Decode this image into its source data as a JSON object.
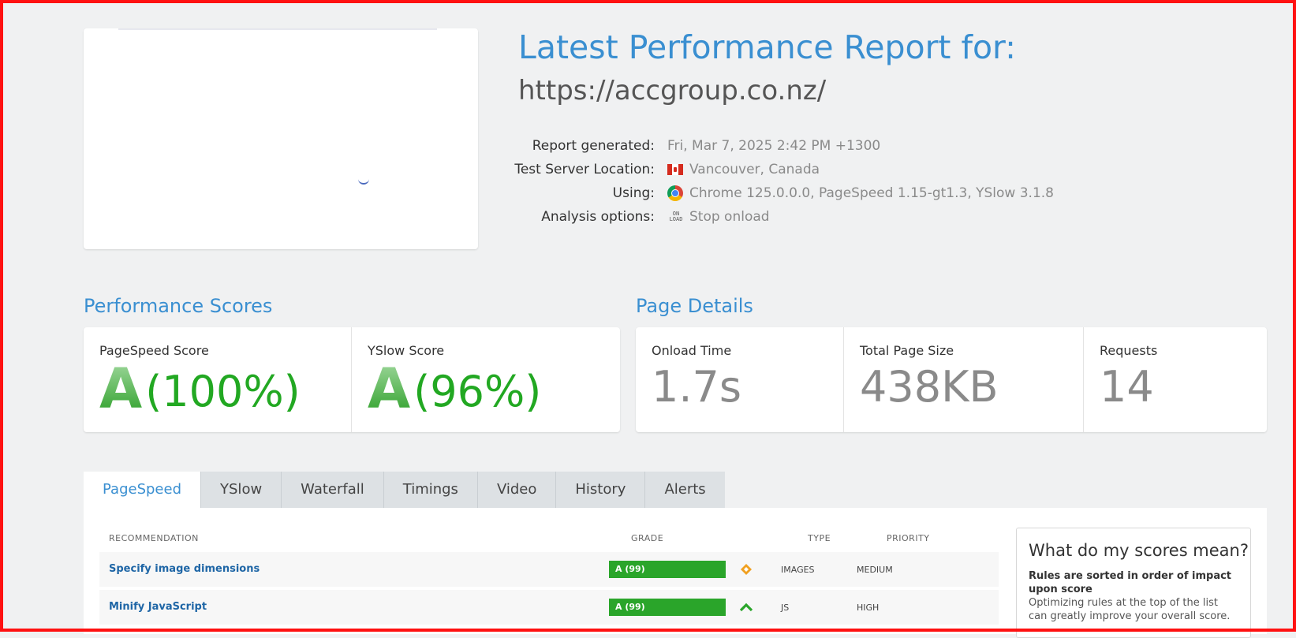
{
  "header": {
    "title": "Latest Performance Report for:",
    "url": "https://accgroup.co.nz/"
  },
  "meta": {
    "report_generated_label": "Report generated:",
    "report_generated_value": "Fri, Mar 7, 2025 2:42 PM +1300",
    "location_label": "Test Server Location:",
    "location_value": "Vancouver, Canada",
    "using_label": "Using:",
    "using_value": "Chrome 125.0.0.0, PageSpeed 1.15-gt1.3, YSlow 3.1.8",
    "analysis_label": "Analysis options:",
    "analysis_icon_line1": "ON",
    "analysis_icon_line2": "LOAD",
    "analysis_value": "Stop onload"
  },
  "scores": {
    "section_title": "Performance Scores",
    "pagespeed_label": "PageSpeed Score",
    "pagespeed_grade": "A",
    "pagespeed_pct": "(100%)",
    "yslow_label": "YSlow Score",
    "yslow_grade": "A",
    "yslow_pct": "(96%)"
  },
  "details": {
    "section_title": "Page Details",
    "onload_label": "Onload Time",
    "onload_value": "1.7s",
    "size_label": "Total Page Size",
    "size_value": "438KB",
    "requests_label": "Requests",
    "requests_value": "14"
  },
  "tabs": [
    {
      "label": "PageSpeed"
    },
    {
      "label": "YSlow"
    },
    {
      "label": "Waterfall"
    },
    {
      "label": "Timings"
    },
    {
      "label": "Video"
    },
    {
      "label": "History"
    },
    {
      "label": "Alerts"
    }
  ],
  "table": {
    "head_recommendation": "RECOMMENDATION",
    "head_grade": "GRADE",
    "head_type": "TYPE",
    "head_priority": "PRIORITY",
    "rows": [
      {
        "name": "Specify image dimensions",
        "grade": "A (99)",
        "type": "IMAGES",
        "priority": "MEDIUM",
        "priority_icon": "diamond-icon"
      },
      {
        "name": "Minify JavaScript",
        "grade": "A (99)",
        "type": "JS",
        "priority": "HIGH",
        "priority_icon": "chevron-up-icon"
      }
    ]
  },
  "score_box": {
    "title": "What do my scores mean?",
    "strong": "Rules are sorted in order of impact upon score",
    "body": "Optimizing rules at the top of the list can greatly improve your overall score."
  },
  "colors": {
    "accent": "#3a8fd1",
    "grade_green": "#2aa52a",
    "priority_medium": "#f0a020",
    "priority_high": "#2aa52a",
    "frame": "#ff1111"
  }
}
